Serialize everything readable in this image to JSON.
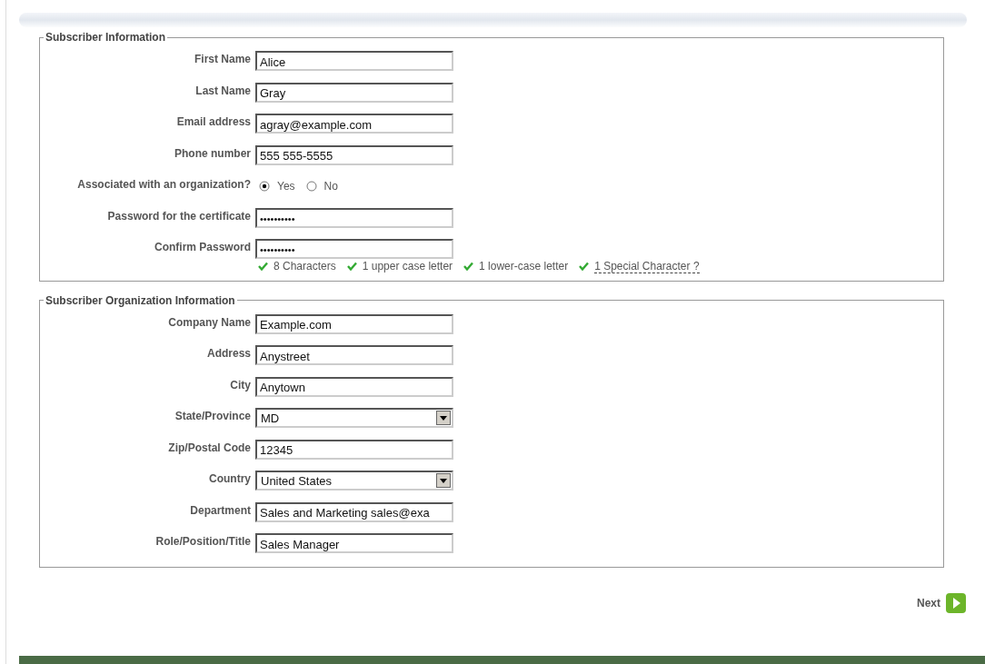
{
  "sections": [
    {
      "title": "Subscriber Information",
      "fields": [
        {
          "kind": "text",
          "label": "First Name",
          "value": "Alice"
        },
        {
          "kind": "text",
          "label": "Last Name",
          "value": "Gray"
        },
        {
          "kind": "text",
          "label": "Email address",
          "value": "agray@example.com"
        },
        {
          "kind": "text",
          "label": "Phone number",
          "value": "555 555-5555"
        },
        {
          "kind": "radio",
          "label": "Associated with an organization?",
          "options": [
            {
              "label": "Yes",
              "selected": true
            },
            {
              "label": "No",
              "selected": false
            }
          ]
        },
        {
          "kind": "password",
          "label": "Password for the certificate",
          "value": "••••••••••"
        },
        {
          "kind": "password",
          "label": "Confirm Password",
          "value": "••••••••••"
        }
      ],
      "requirements": [
        {
          "kind": "plain",
          "text": "8 Characters",
          "met": true
        },
        {
          "kind": "plain",
          "text": "1 upper case letter",
          "met": true
        },
        {
          "kind": "plain",
          "text": "1 lower-case letter",
          "met": true
        },
        {
          "kind": "hint",
          "text": "1 Special Character ?",
          "met": true
        }
      ]
    },
    {
      "title": "Subscriber Organization Information",
      "fields": [
        {
          "kind": "text",
          "label": "Company Name",
          "value": "Example.com"
        },
        {
          "kind": "text",
          "label": "Address",
          "value": "Anystreet"
        },
        {
          "kind": "text",
          "label": "City",
          "value": "Anytown"
        },
        {
          "kind": "select",
          "label": "State/Province",
          "value": "MD"
        },
        {
          "kind": "text",
          "label": "Zip/Postal Code",
          "value": "12345"
        },
        {
          "kind": "select",
          "label": "Country",
          "value": "United States"
        },
        {
          "kind": "text",
          "label": "Department",
          "value": "Sales and Marketing sales@exa"
        },
        {
          "kind": "text",
          "label": "Role/Position/Title",
          "value": "Sales Manager"
        }
      ]
    }
  ],
  "next_button": "Next"
}
